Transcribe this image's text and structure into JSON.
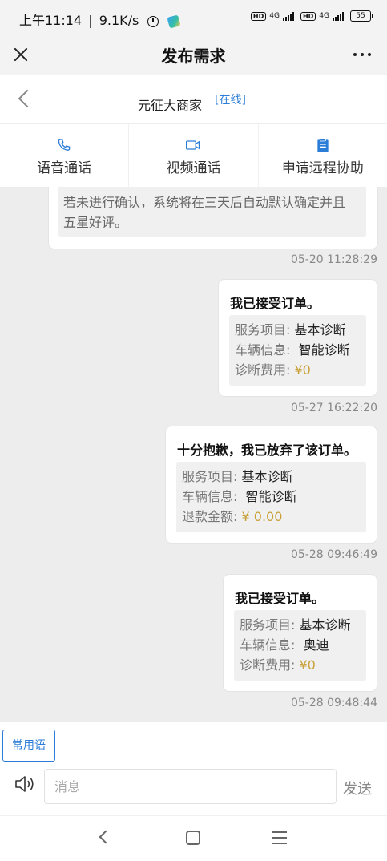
{
  "status_bar": {
    "time": "上午11:14",
    "net_speed": "9.1K/s",
    "hd1": "HD",
    "net1": "4G",
    "hd2": "HD",
    "net2": "4G",
    "battery": "55"
  },
  "header": {
    "title": "发布需求"
  },
  "shop": {
    "name": "元征大商家",
    "status": "[在线]"
  },
  "actions": [
    {
      "label": "语音通话",
      "icon": "phone-icon"
    },
    {
      "label": "视频通话",
      "icon": "video-icon"
    },
    {
      "label": "申请远程协助",
      "icon": "clipboard-icon"
    }
  ],
  "messages": [
    {
      "partial_text": "若未进行确认，系统将在三天后自动默认确定并且五星好评。",
      "line1": "若未进行确认，系统将在三天后自动默认确定并且",
      "line2": "五星好评。",
      "time": "05-20 11:28:29"
    },
    {
      "title": "我已接受订单。",
      "rows": [
        {
          "key": "服务项目:",
          "value": "基本诊断"
        },
        {
          "key": "车辆信息:",
          "value": "智能诊断"
        },
        {
          "key": "诊断费用:",
          "value": "¥0"
        }
      ],
      "time": "05-27 16:22:20"
    },
    {
      "title": "十分抱歉，我已放弃了该订单。",
      "rows": [
        {
          "key": "服务项目:",
          "value": "基本诊断"
        },
        {
          "key": "车辆信息:",
          "value": "智能诊断"
        },
        {
          "key": "退款金额:",
          "value": "¥ 0.00"
        }
      ],
      "time": "05-28 09:46:49"
    },
    {
      "title": "我已接受订单。",
      "rows": [
        {
          "key": "服务项目:",
          "value": "基本诊断"
        },
        {
          "key": "车辆信息:",
          "value": "奥迪"
        },
        {
          "key": "诊断费用:",
          "value": "¥0"
        }
      ],
      "time": "05-28 09:48:44"
    }
  ],
  "input": {
    "common_phrases": "常用语",
    "placeholder": "消息",
    "send": "发送"
  },
  "colors": {
    "accent": "#2b7dd7",
    "money": "#c9a13a",
    "chat_bg": "#ededed"
  }
}
